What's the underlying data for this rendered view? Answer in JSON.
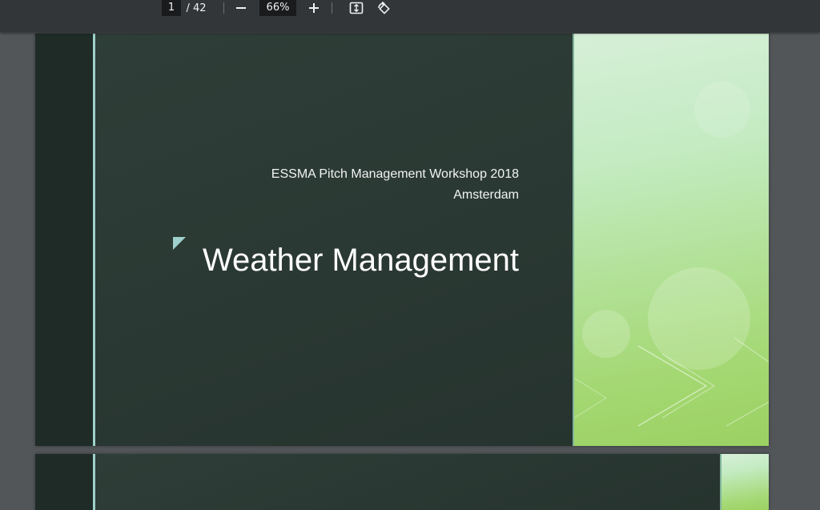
{
  "toolbar": {
    "current_page": "1",
    "total_pages": "/ 42",
    "zoom": "66%",
    "icons": [
      "minus-icon",
      "plus-icon",
      "fit-page-icon",
      "rotate-icon"
    ]
  },
  "slide1": {
    "subtitle_line1": "ESSMA Pitch Management Workshop 2018",
    "subtitle_line2": "Amsterdam",
    "title": "Weather Management"
  },
  "colors": {
    "toolbar_bg": "#323639",
    "viewer_bg": "#525659",
    "slide_dark": "#2a3833",
    "accent_teal": "#9fd0cc",
    "panel_green": "#a4d873"
  }
}
